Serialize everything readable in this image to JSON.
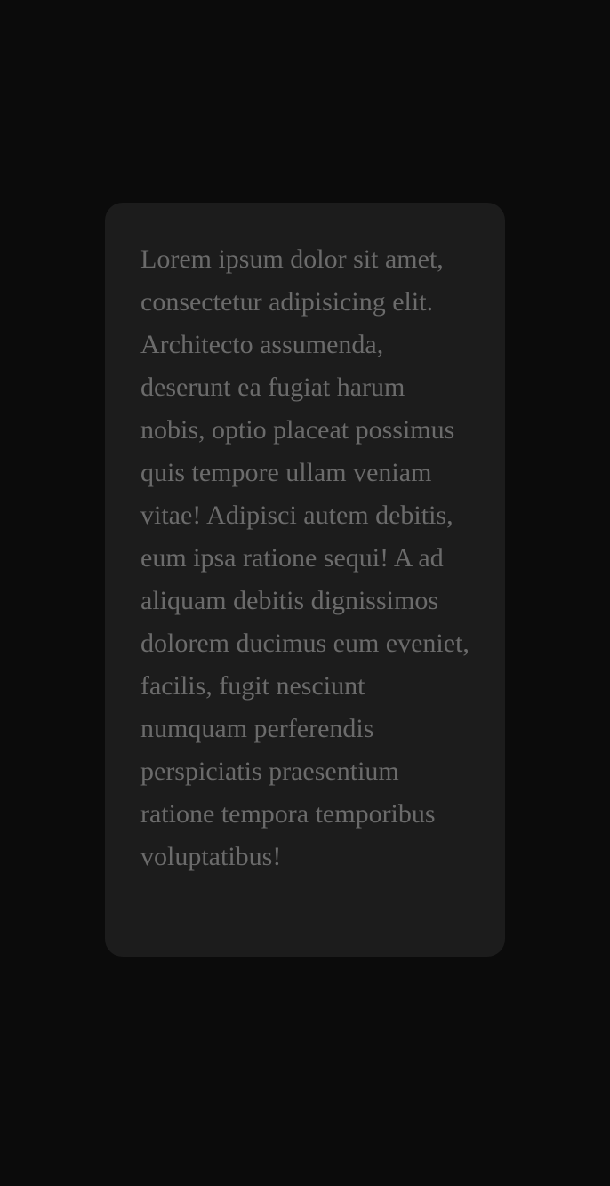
{
  "card": {
    "text": "Lorem ipsum dolor sit amet, consectetur adipisicing elit. Architecto assumenda, deserunt ea fugiat harum nobis, optio placeat possimus quis tempore ullam veniam vitae! Adipisci autem debitis, eum ipsa ratione sequi! A ad aliquam debitis dignissimos dolorem ducimus eum eveniet, facilis, fugit nesciunt numquam perferendis perspiciatis praesentium ratione tempora temporibus voluptatibus!"
  },
  "colors": {
    "background": "#0b0b0b",
    "card_background": "#1c1c1c",
    "text": "#6b6b6b"
  }
}
